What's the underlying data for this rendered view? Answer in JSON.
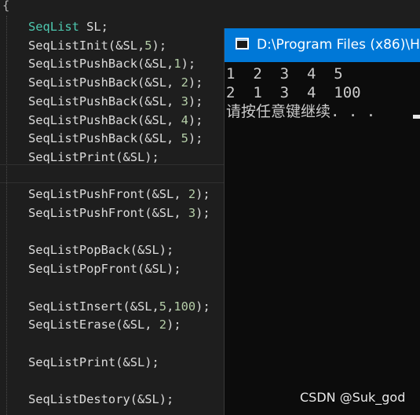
{
  "editor": {
    "open_brace": "{",
    "lines": [
      {
        "tokens": [
          {
            "text": "SeqList",
            "kind": "type"
          },
          {
            "text": " SL;",
            "kind": "plain"
          }
        ]
      },
      {
        "tokens": [
          {
            "text": "SeqListInit(&SL,",
            "kind": "plain"
          },
          {
            "text": "5",
            "kind": "num"
          },
          {
            "text": ");",
            "kind": "plain"
          }
        ]
      },
      {
        "tokens": [
          {
            "text": "SeqListPushBack(&SL,",
            "kind": "plain"
          },
          {
            "text": "1",
            "kind": "num"
          },
          {
            "text": ");",
            "kind": "plain"
          }
        ]
      },
      {
        "tokens": [
          {
            "text": "SeqListPushBack(&SL, ",
            "kind": "plain"
          },
          {
            "text": "2",
            "kind": "num"
          },
          {
            "text": ");",
            "kind": "plain"
          }
        ]
      },
      {
        "tokens": [
          {
            "text": "SeqListPushBack(&SL, ",
            "kind": "plain"
          },
          {
            "text": "3",
            "kind": "num"
          },
          {
            "text": ");",
            "kind": "plain"
          }
        ]
      },
      {
        "tokens": [
          {
            "text": "SeqListPushBack(&SL, ",
            "kind": "plain"
          },
          {
            "text": "4",
            "kind": "num"
          },
          {
            "text": ");",
            "kind": "plain"
          }
        ]
      },
      {
        "tokens": [
          {
            "text": "SeqListPushBack(&SL, ",
            "kind": "plain"
          },
          {
            "text": "5",
            "kind": "num"
          },
          {
            "text": ");",
            "kind": "plain"
          }
        ]
      },
      {
        "tokens": [
          {
            "text": "SeqListPrint(&SL);",
            "kind": "plain"
          }
        ]
      },
      {
        "tokens": []
      },
      {
        "tokens": [
          {
            "text": "SeqListPushFront(&SL, ",
            "kind": "plain"
          },
          {
            "text": "2",
            "kind": "num"
          },
          {
            "text": ");",
            "kind": "plain"
          }
        ]
      },
      {
        "tokens": [
          {
            "text": "SeqListPushFront(&SL, ",
            "kind": "plain"
          },
          {
            "text": "3",
            "kind": "num"
          },
          {
            "text": ");",
            "kind": "plain"
          }
        ]
      },
      {
        "tokens": []
      },
      {
        "tokens": [
          {
            "text": "SeqListPopBack(&SL);",
            "kind": "plain"
          }
        ]
      },
      {
        "tokens": [
          {
            "text": "SeqListPopFront(&SL);",
            "kind": "plain"
          }
        ]
      },
      {
        "tokens": []
      },
      {
        "tokens": [
          {
            "text": "SeqListInsert(&SL,",
            "kind": "plain"
          },
          {
            "text": "5",
            "kind": "num"
          },
          {
            "text": ",",
            "kind": "plain"
          },
          {
            "text": "100",
            "kind": "num"
          },
          {
            "text": ");",
            "kind": "plain"
          }
        ]
      },
      {
        "tokens": [
          {
            "text": "SeqListErase(&SL, ",
            "kind": "plain"
          },
          {
            "text": "2",
            "kind": "num"
          },
          {
            "text": ");",
            "kind": "plain"
          }
        ]
      },
      {
        "tokens": []
      },
      {
        "tokens": [
          {
            "text": "SeqListPrint(&SL);",
            "kind": "plain"
          }
        ]
      },
      {
        "tokens": []
      },
      {
        "tokens": [
          {
            "text": "SeqListDestory(&SL);",
            "kind": "plain"
          }
        ]
      }
    ]
  },
  "console": {
    "title": "D:\\Program Files (x86)\\H",
    "icon": "console-window-icon",
    "output_lines": [
      "1  2  3  4  5",
      "2  1  3  4  100",
      "请按任意键继续. . ."
    ]
  },
  "watermark": "CSDN @Suk_god",
  "colors": {
    "background": "#1e1e1e",
    "type": "#4ec9b0",
    "number": "#b5cea8",
    "text": "#dcdcdc",
    "titlebar": "#0078d7",
    "console_bg": "#0c0c0c"
  }
}
